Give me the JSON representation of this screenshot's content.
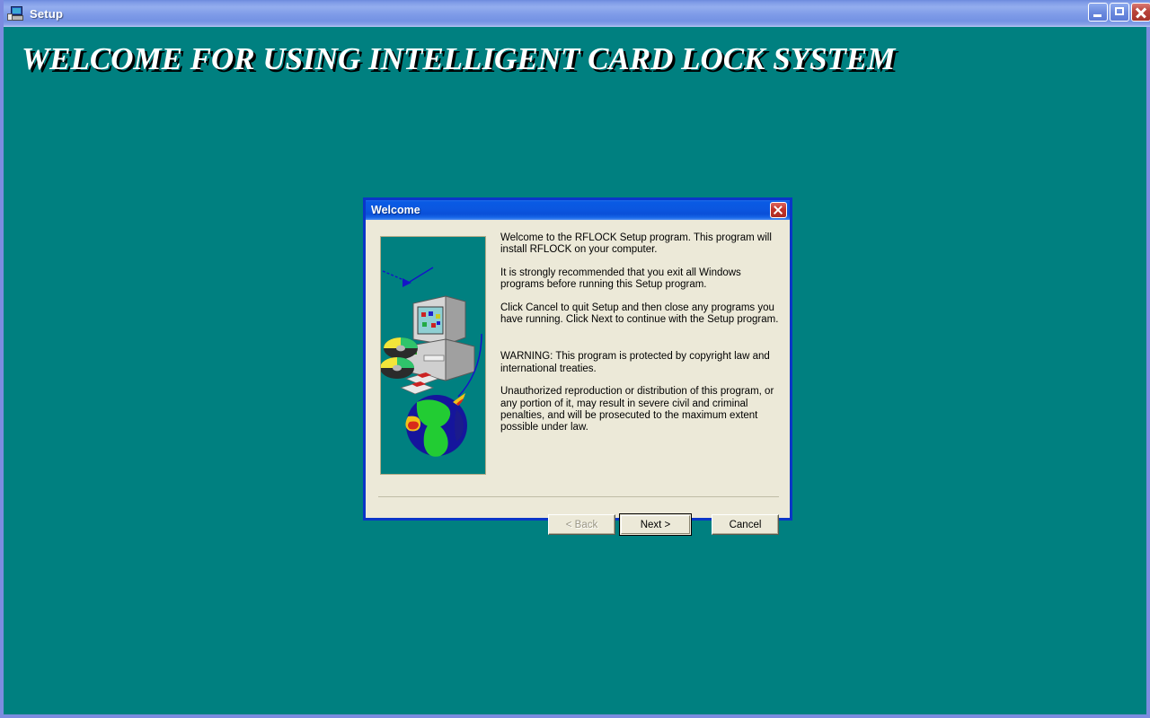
{
  "main_window": {
    "title": "Setup",
    "icon": "setup-computer-icon",
    "background_color": "#008080",
    "frame_color": "#7c8ce0",
    "titlebar_color": "#7e9ae6",
    "controls": {
      "minimize": "minimize-icon",
      "maximize": "maximize-icon",
      "close": "close-icon"
    }
  },
  "banner": {
    "heading": "WELCOME FOR USING INTELLIGENT CARD LOCK SYSTEM",
    "text_color": "#ffffff",
    "shadow_color": "#000000"
  },
  "dialog": {
    "title": "Welcome",
    "close_icon": "close-icon",
    "titlebar_color": "#0b57e0",
    "body_color": "#ece9d8",
    "border_color": "#0a36c8",
    "illustration": {
      "name": "setup-illustration",
      "background_color": "#008080",
      "elements": [
        "computer-monitor",
        "computer-case",
        "compact-discs",
        "floppy-disks",
        "globe",
        "network-arrows"
      ]
    },
    "paragraphs": [
      "Welcome to the RFLOCK Setup program.  This program will install RFLOCK on your computer.",
      "It is strongly recommended that you exit all Windows programs before running this Setup program.",
      "Click Cancel to quit Setup and then close any programs you have running.  Click Next to continue with the Setup program.",
      "WARNING: This program is protected by copyright law and international treaties.",
      "Unauthorized reproduction or distribution of this program, or any portion of it, may result in severe civil and criminal penalties, and will be prosecuted to the maximum extent possible under law."
    ],
    "buttons": {
      "back": "< Back",
      "next": "Next >",
      "cancel": "Cancel"
    }
  }
}
